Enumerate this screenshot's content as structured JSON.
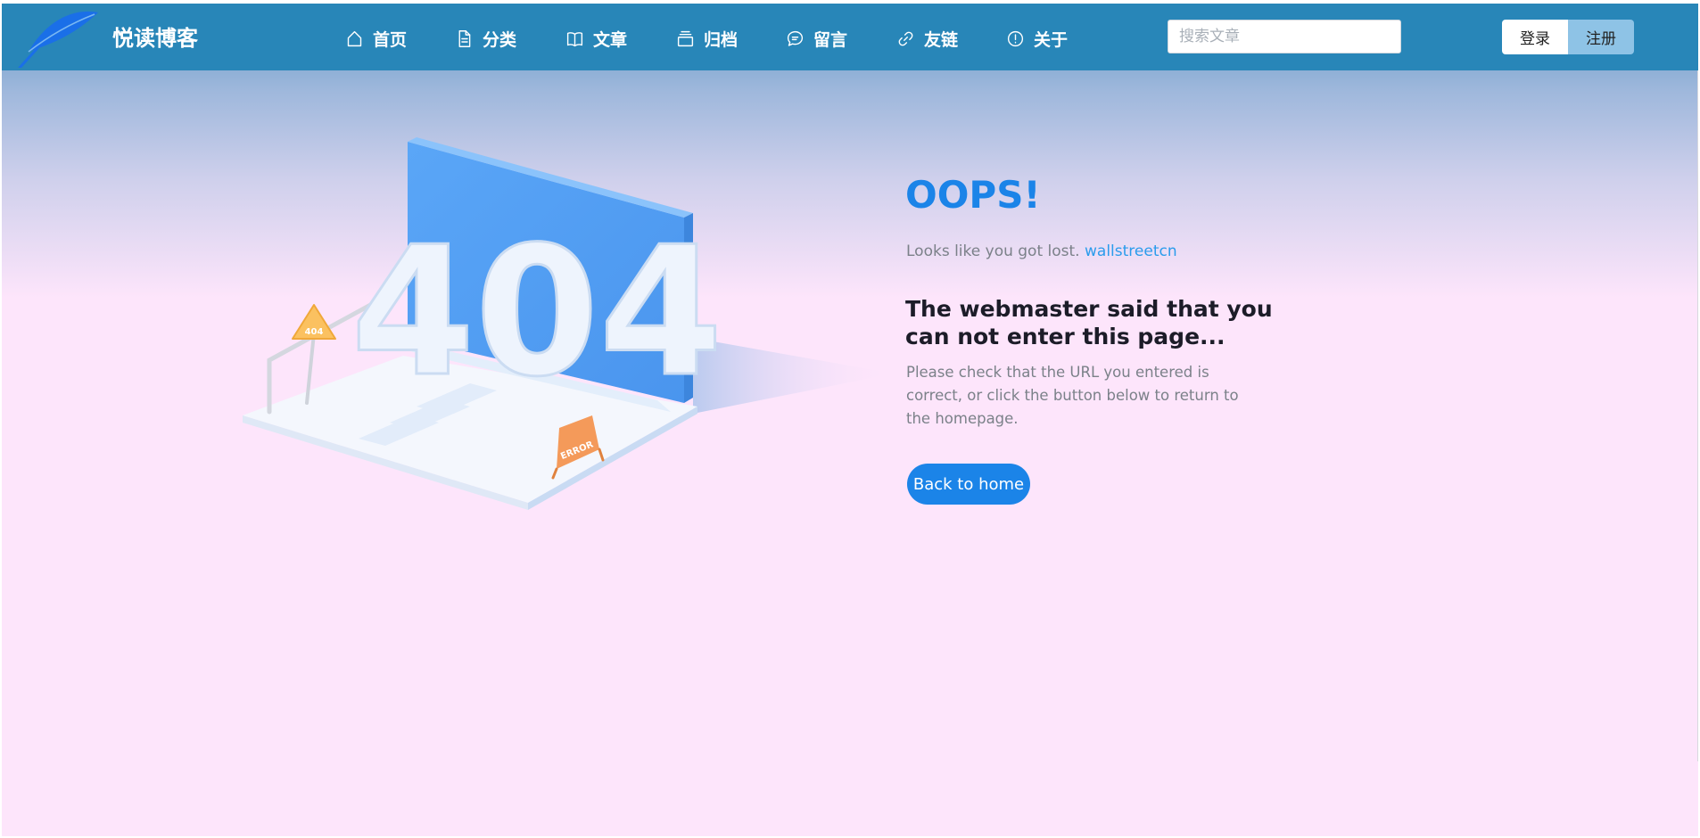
{
  "header": {
    "site_name": "悦读博客",
    "nav": [
      {
        "label": "首页",
        "icon": "home-icon"
      },
      {
        "label": "分类",
        "icon": "document-icon"
      },
      {
        "label": "文章",
        "icon": "book-icon"
      },
      {
        "label": "归档",
        "icon": "archive-icon"
      },
      {
        "label": "留言",
        "icon": "message-icon"
      },
      {
        "label": "友链",
        "icon": "link-icon"
      },
      {
        "label": "关于",
        "icon": "info-icon"
      }
    ],
    "search_placeholder": "搜索文章",
    "login_label": "登录",
    "register_label": "注册"
  },
  "illustration": {
    "big_text": "404",
    "sign_text": "404",
    "board_text": "ERROR"
  },
  "error": {
    "title": "OOPS!",
    "lost_text": "Looks like you got lost.",
    "lost_link": "wallstreetcn",
    "headline": "The webmaster said that you can not enter this page...",
    "description": "Please check that the URL you entered is correct, or click the button below to return to the homepage.",
    "home_button": "Back to home"
  },
  "colors": {
    "navbar": "#2886b8",
    "accent": "#1b84e8",
    "link": "#2a9cec",
    "background": "#fde5fb",
    "register_button": "#8ec3e6"
  }
}
